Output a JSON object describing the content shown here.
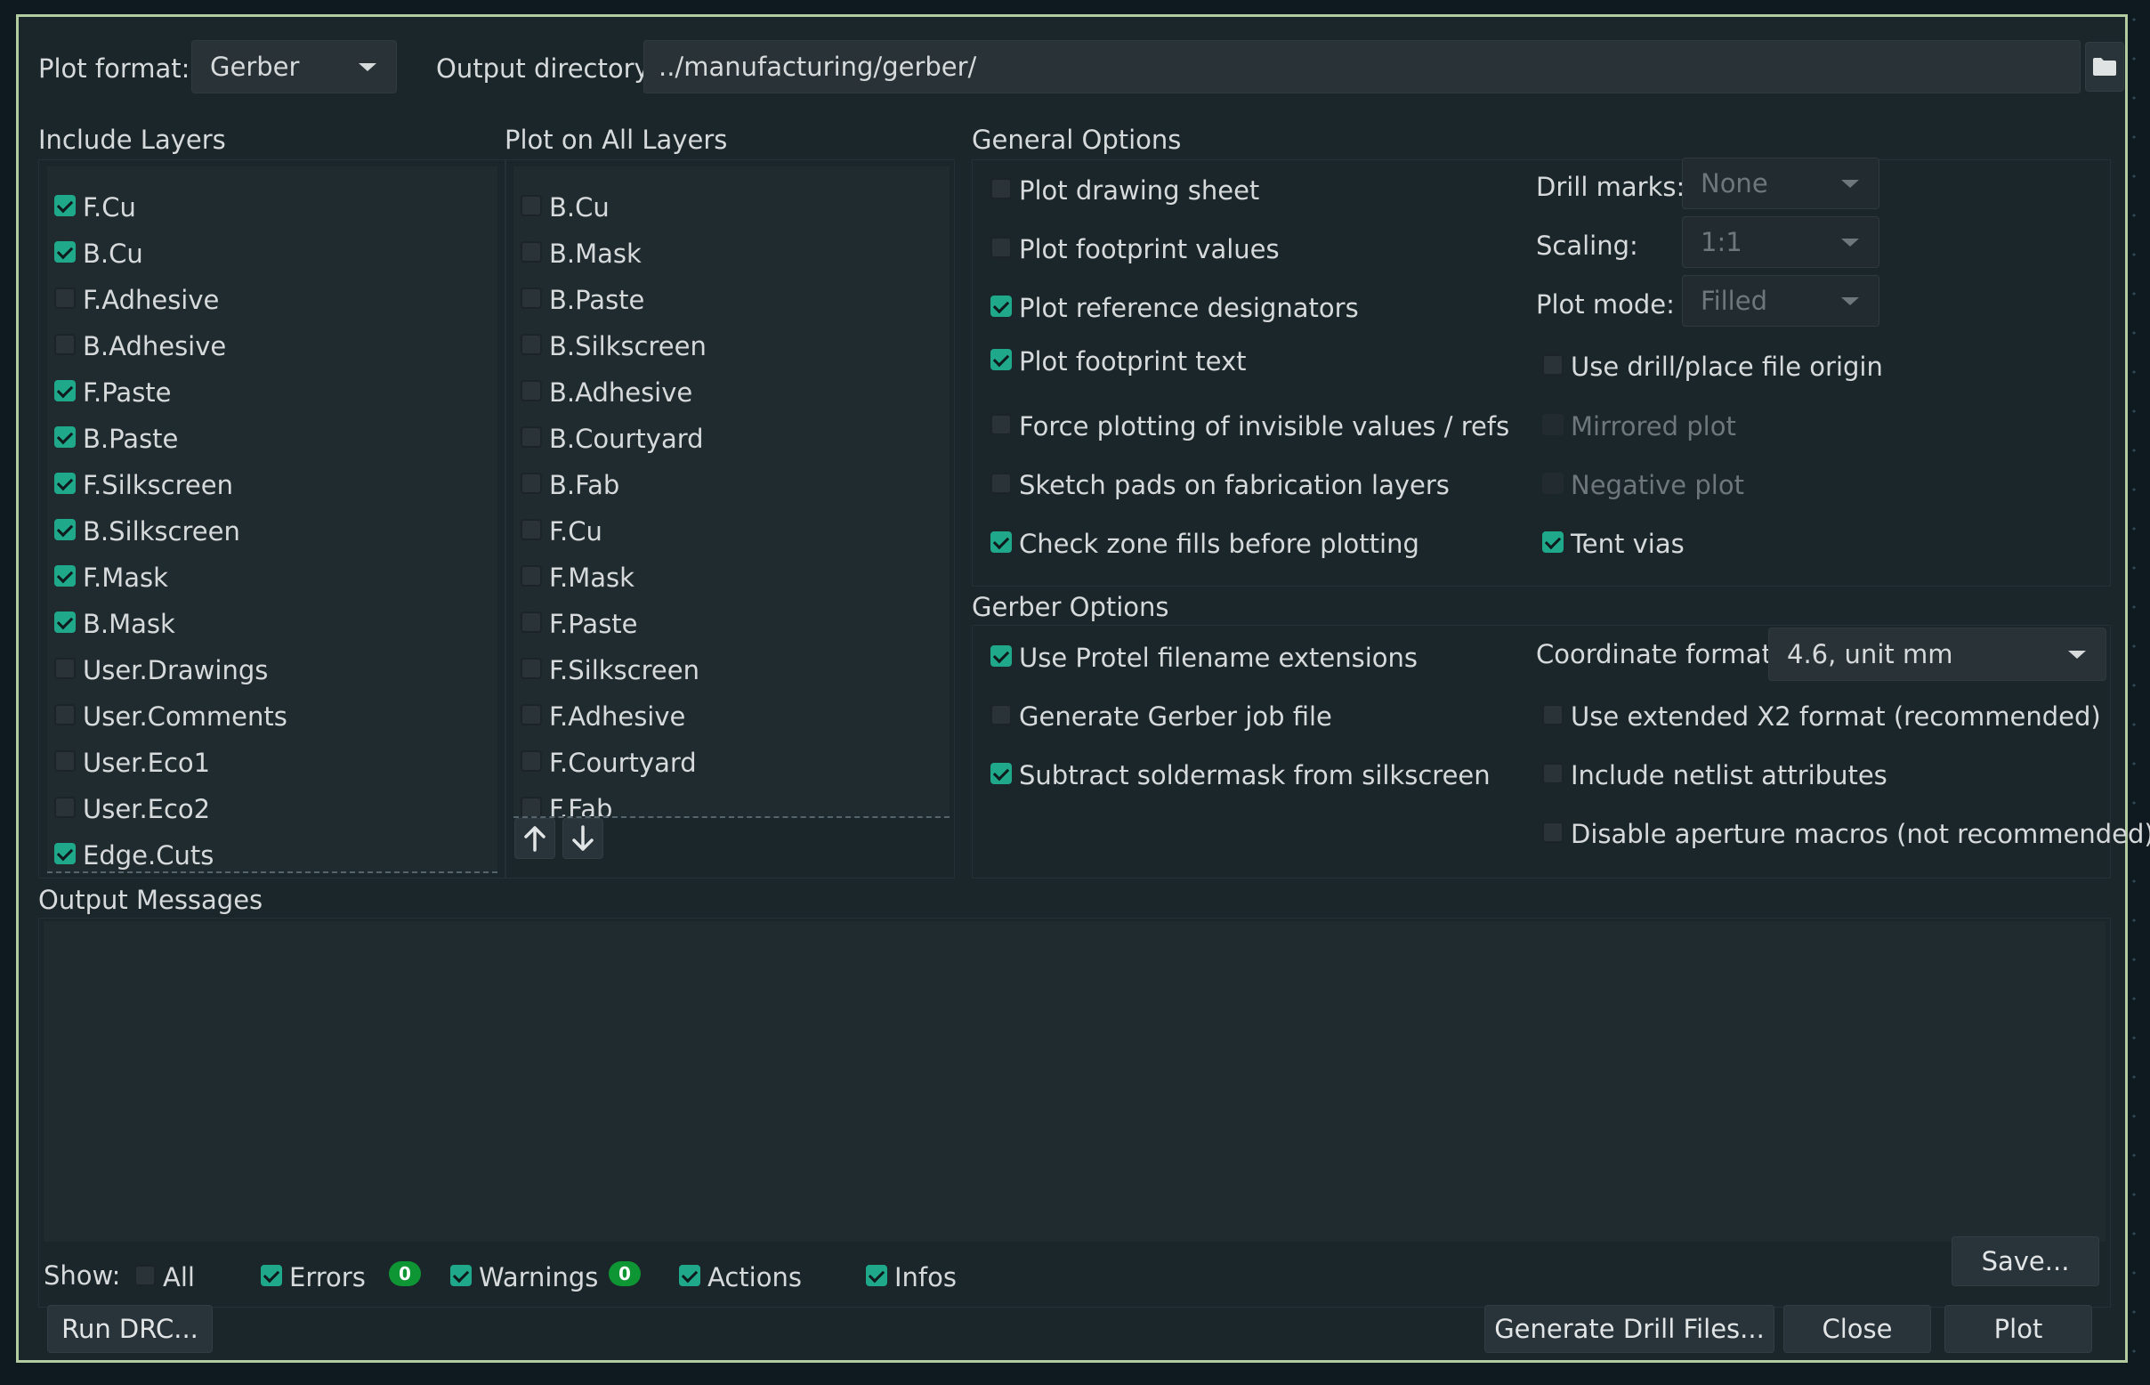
{
  "top": {
    "plot_format_label": "Plot format:",
    "plot_format_value": "Gerber",
    "output_dir_label": "Output directory:",
    "output_dir_value": "../manufacturing/gerber/",
    "folder_icon": "folder-icon"
  },
  "include_layers": {
    "title": "Include Layers",
    "items": [
      {
        "label": "F.Cu",
        "checked": true
      },
      {
        "label": "B.Cu",
        "checked": true
      },
      {
        "label": "F.Adhesive",
        "checked": false
      },
      {
        "label": "B.Adhesive",
        "checked": false
      },
      {
        "label": "F.Paste",
        "checked": true
      },
      {
        "label": "B.Paste",
        "checked": true
      },
      {
        "label": "F.Silkscreen",
        "checked": true
      },
      {
        "label": "B.Silkscreen",
        "checked": true
      },
      {
        "label": "F.Mask",
        "checked": true
      },
      {
        "label": "B.Mask",
        "checked": true
      },
      {
        "label": "User.Drawings",
        "checked": false
      },
      {
        "label": "User.Comments",
        "checked": false
      },
      {
        "label": "User.Eco1",
        "checked": false
      },
      {
        "label": "User.Eco2",
        "checked": false
      },
      {
        "label": "Edge.Cuts",
        "checked": true
      }
    ]
  },
  "plot_all_layers": {
    "title": "Plot on All Layers",
    "items": [
      {
        "label": "B.Cu",
        "checked": false
      },
      {
        "label": "B.Mask",
        "checked": false
      },
      {
        "label": "B.Paste",
        "checked": false
      },
      {
        "label": "B.Silkscreen",
        "checked": false
      },
      {
        "label": "B.Adhesive",
        "checked": false
      },
      {
        "label": "B.Courtyard",
        "checked": false
      },
      {
        "label": "B.Fab",
        "checked": false
      },
      {
        "label": "F.Cu",
        "checked": false
      },
      {
        "label": "F.Mask",
        "checked": false
      },
      {
        "label": "F.Paste",
        "checked": false
      },
      {
        "label": "F.Silkscreen",
        "checked": false
      },
      {
        "label": "F.Adhesive",
        "checked": false
      },
      {
        "label": "F.Courtyard",
        "checked": false
      },
      {
        "label": "F.Fab",
        "checked": false
      }
    ],
    "up_icon": "arrow-up-icon",
    "down_icon": "arrow-down-icon"
  },
  "general": {
    "title": "General Options",
    "left": [
      {
        "label": "Plot drawing sheet",
        "checked": false
      },
      {
        "label": "Plot footprint values",
        "checked": false
      },
      {
        "label": "Plot reference designators",
        "checked": true
      },
      {
        "label": "Plot footprint text",
        "checked": true
      },
      {
        "label": "Force plotting of invisible values / refs",
        "checked": false
      },
      {
        "label": "Sketch pads on fabrication layers",
        "checked": false
      },
      {
        "label": "Check zone fills before plotting",
        "checked": true
      }
    ],
    "drill_marks_label": "Drill marks:",
    "drill_marks_value": "None",
    "scaling_label": "Scaling:",
    "scaling_value": "1:1",
    "plot_mode_label": "Plot mode:",
    "plot_mode_value": "Filled",
    "right": [
      {
        "label": "Use drill/place file origin",
        "checked": false,
        "disabled": false
      },
      {
        "label": "Mirrored plot",
        "checked": false,
        "disabled": true
      },
      {
        "label": "Negative plot",
        "checked": false,
        "disabled": true
      },
      {
        "label": "Tent vias",
        "checked": true,
        "disabled": false
      }
    ]
  },
  "gerber": {
    "title": "Gerber Options",
    "left": [
      {
        "label": "Use Protel filename extensions",
        "checked": true
      },
      {
        "label": "Generate Gerber job file",
        "checked": false
      },
      {
        "label": "Subtract soldermask from silkscreen",
        "checked": true
      }
    ],
    "coord_label": "Coordinate format:",
    "coord_value": "4.6, unit mm",
    "right": [
      {
        "label": "Use extended X2 format (recommended)",
        "checked": false
      },
      {
        "label": "Include netlist attributes",
        "checked": false
      },
      {
        "label": "Disable aperture macros (not recommended)",
        "checked": false
      }
    ]
  },
  "messages": {
    "title": "Output Messages",
    "show_label": "Show:",
    "filters": [
      {
        "label": "All",
        "checked": false
      },
      {
        "label": "Errors",
        "checked": true,
        "badge": "0"
      },
      {
        "label": "Warnings",
        "checked": true,
        "badge": "0"
      },
      {
        "label": "Actions",
        "checked": true
      },
      {
        "label": "Infos",
        "checked": true
      }
    ],
    "save_label": "Save..."
  },
  "footer": {
    "run_drc": "Run DRC...",
    "gen_drill": "Generate Drill Files...",
    "close": "Close",
    "plot": "Plot"
  },
  "colors": {
    "accent": "#1fa88a",
    "badge": "#0f9634",
    "border": "#b3cba0",
    "background": "#1b262b"
  }
}
